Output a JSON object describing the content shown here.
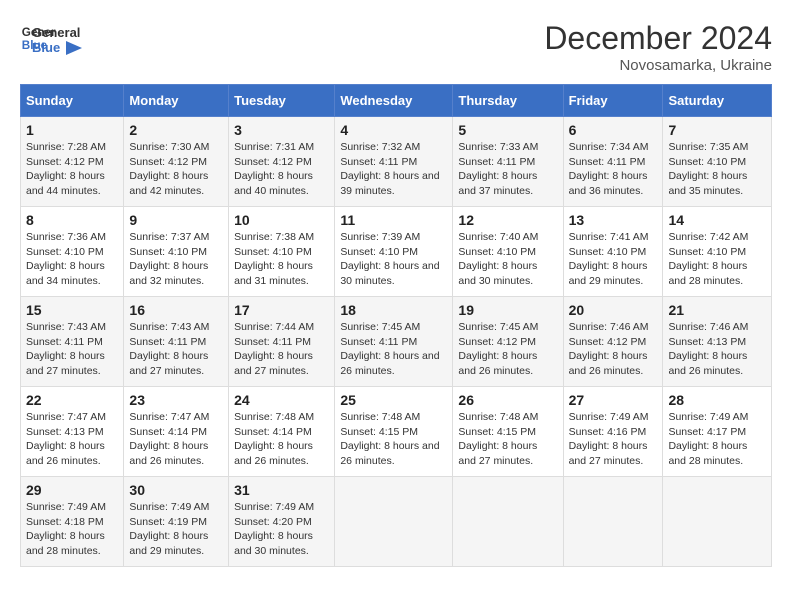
{
  "header": {
    "logo_line1": "General",
    "logo_line2": "Blue",
    "month": "December 2024",
    "location": "Novosamarka, Ukraine"
  },
  "weekdays": [
    "Sunday",
    "Monday",
    "Tuesday",
    "Wednesday",
    "Thursday",
    "Friday",
    "Saturday"
  ],
  "weeks": [
    [
      {
        "day": "1",
        "sunrise": "7:28 AM",
        "sunset": "4:12 PM",
        "daylight": "8 hours and 44 minutes."
      },
      {
        "day": "2",
        "sunrise": "7:30 AM",
        "sunset": "4:12 PM",
        "daylight": "8 hours and 42 minutes."
      },
      {
        "day": "3",
        "sunrise": "7:31 AM",
        "sunset": "4:12 PM",
        "daylight": "8 hours and 40 minutes."
      },
      {
        "day": "4",
        "sunrise": "7:32 AM",
        "sunset": "4:11 PM",
        "daylight": "8 hours and 39 minutes."
      },
      {
        "day": "5",
        "sunrise": "7:33 AM",
        "sunset": "4:11 PM",
        "daylight": "8 hours and 37 minutes."
      },
      {
        "day": "6",
        "sunrise": "7:34 AM",
        "sunset": "4:11 PM",
        "daylight": "8 hours and 36 minutes."
      },
      {
        "day": "7",
        "sunrise": "7:35 AM",
        "sunset": "4:10 PM",
        "daylight": "8 hours and 35 minutes."
      }
    ],
    [
      {
        "day": "8",
        "sunrise": "7:36 AM",
        "sunset": "4:10 PM",
        "daylight": "8 hours and 34 minutes."
      },
      {
        "day": "9",
        "sunrise": "7:37 AM",
        "sunset": "4:10 PM",
        "daylight": "8 hours and 32 minutes."
      },
      {
        "day": "10",
        "sunrise": "7:38 AM",
        "sunset": "4:10 PM",
        "daylight": "8 hours and 31 minutes."
      },
      {
        "day": "11",
        "sunrise": "7:39 AM",
        "sunset": "4:10 PM",
        "daylight": "8 hours and 30 minutes."
      },
      {
        "day": "12",
        "sunrise": "7:40 AM",
        "sunset": "4:10 PM",
        "daylight": "8 hours and 30 minutes."
      },
      {
        "day": "13",
        "sunrise": "7:41 AM",
        "sunset": "4:10 PM",
        "daylight": "8 hours and 29 minutes."
      },
      {
        "day": "14",
        "sunrise": "7:42 AM",
        "sunset": "4:10 PM",
        "daylight": "8 hours and 28 minutes."
      }
    ],
    [
      {
        "day": "15",
        "sunrise": "7:43 AM",
        "sunset": "4:11 PM",
        "daylight": "8 hours and 27 minutes."
      },
      {
        "day": "16",
        "sunrise": "7:43 AM",
        "sunset": "4:11 PM",
        "daylight": "8 hours and 27 minutes."
      },
      {
        "day": "17",
        "sunrise": "7:44 AM",
        "sunset": "4:11 PM",
        "daylight": "8 hours and 27 minutes."
      },
      {
        "day": "18",
        "sunrise": "7:45 AM",
        "sunset": "4:11 PM",
        "daylight": "8 hours and 26 minutes."
      },
      {
        "day": "19",
        "sunrise": "7:45 AM",
        "sunset": "4:12 PM",
        "daylight": "8 hours and 26 minutes."
      },
      {
        "day": "20",
        "sunrise": "7:46 AM",
        "sunset": "4:12 PM",
        "daylight": "8 hours and 26 minutes."
      },
      {
        "day": "21",
        "sunrise": "7:46 AM",
        "sunset": "4:13 PM",
        "daylight": "8 hours and 26 minutes."
      }
    ],
    [
      {
        "day": "22",
        "sunrise": "7:47 AM",
        "sunset": "4:13 PM",
        "daylight": "8 hours and 26 minutes."
      },
      {
        "day": "23",
        "sunrise": "7:47 AM",
        "sunset": "4:14 PM",
        "daylight": "8 hours and 26 minutes."
      },
      {
        "day": "24",
        "sunrise": "7:48 AM",
        "sunset": "4:14 PM",
        "daylight": "8 hours and 26 minutes."
      },
      {
        "day": "25",
        "sunrise": "7:48 AM",
        "sunset": "4:15 PM",
        "daylight": "8 hours and 26 minutes."
      },
      {
        "day": "26",
        "sunrise": "7:48 AM",
        "sunset": "4:15 PM",
        "daylight": "8 hours and 27 minutes."
      },
      {
        "day": "27",
        "sunrise": "7:49 AM",
        "sunset": "4:16 PM",
        "daylight": "8 hours and 27 minutes."
      },
      {
        "day": "28",
        "sunrise": "7:49 AM",
        "sunset": "4:17 PM",
        "daylight": "8 hours and 28 minutes."
      }
    ],
    [
      {
        "day": "29",
        "sunrise": "7:49 AM",
        "sunset": "4:18 PM",
        "daylight": "8 hours and 28 minutes."
      },
      {
        "day": "30",
        "sunrise": "7:49 AM",
        "sunset": "4:19 PM",
        "daylight": "8 hours and 29 minutes."
      },
      {
        "day": "31",
        "sunrise": "7:49 AM",
        "sunset": "4:20 PM",
        "daylight": "8 hours and 30 minutes."
      },
      null,
      null,
      null,
      null
    ]
  ]
}
